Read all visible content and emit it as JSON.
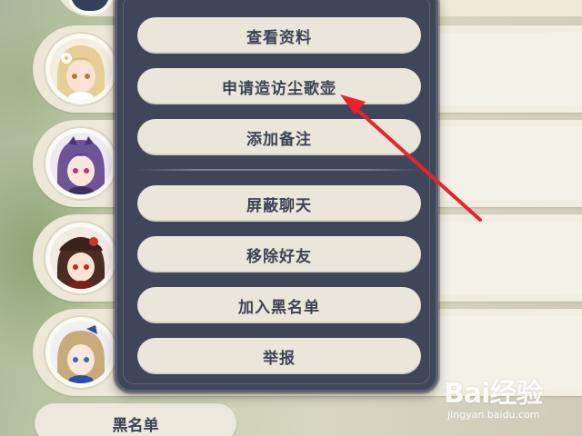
{
  "menu": {
    "items": [
      {
        "label": "查看资料"
      },
      {
        "label": "申请造访尘歌壶"
      },
      {
        "label": "添加备注"
      },
      {
        "label": "屏蔽聊天"
      },
      {
        "label": "移除好友"
      },
      {
        "label": "加入黑名单"
      },
      {
        "label": "举报"
      }
    ]
  },
  "bottom_tabs": {
    "blacklist_label": "黑名单"
  },
  "watermark": {
    "logo": "Bai经验",
    "url": "jingyan.baidu.com"
  },
  "colors": {
    "menu_bg": "#404659",
    "button_bg": "#ebe6da",
    "button_text": "#3d4356",
    "annotation_arrow": "#e8232d"
  },
  "icons": [
    "paw-icon",
    "arrow-annotation"
  ]
}
